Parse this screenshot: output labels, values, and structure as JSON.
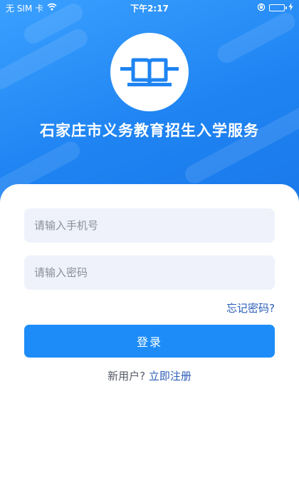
{
  "status_bar": {
    "carrier": "无 SIM 卡",
    "time": "下午2:17"
  },
  "app": {
    "title": "石家庄市义务教育招生入学服务"
  },
  "login_form": {
    "phone_placeholder": "请输入手机号",
    "password_placeholder": "请输入密码",
    "forgot_password": "忘记密码?",
    "login_button": "登录",
    "new_user_prompt": "新用户?",
    "register_link": "立即注册"
  },
  "colors": {
    "hero_blue": "#1f84f2",
    "button_blue": "#1d8cf8",
    "link_blue": "#2b5db8",
    "input_bg": "#eff2fb"
  },
  "icons": {
    "logo": "open-book-icon",
    "wifi": "wifi-icon",
    "orientation_lock": "orientation-lock-icon",
    "battery": "battery-charging-icon"
  }
}
